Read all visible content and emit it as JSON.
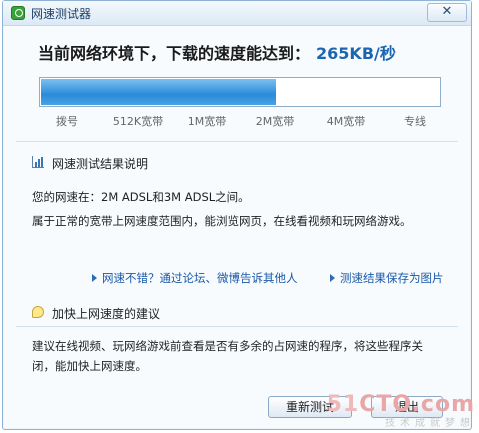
{
  "window": {
    "title": "网速测试器",
    "close_glyph": "✕"
  },
  "result": {
    "headline_prefix": "当前网络环境下，下载的速度能达到：",
    "speed": "265KB/秒",
    "progress_fraction": 0.59
  },
  "scale_labels": [
    "拨号",
    "512K宽带",
    "1M宽带",
    "2M宽带",
    "4M宽带",
    "专线"
  ],
  "explain_section": {
    "title": "网速测试结果说明",
    "line1": "您的网速在：2M ADSL和3M ADSL之间。",
    "line2": "属于正常的宽带上网速度范围内，能浏览网页，在线看视频和玩网络游戏。"
  },
  "links": {
    "share": "网速不错？通过论坛、微博告诉其他人",
    "save": "测速结果保存为图片"
  },
  "suggest_section": {
    "title": "加快上网速度的建议",
    "line1": "建议在线视频、玩网络游戏前查看是否有多余的占网速的程序，将这些程序关",
    "line2": "闭，能加快上网速度。"
  },
  "buttons": {
    "retest": "重新测试",
    "exit": "退出"
  },
  "watermark": {
    "logo_num": "51",
    "logo_text": "CTO.com",
    "sub": "技术成就梦想"
  }
}
